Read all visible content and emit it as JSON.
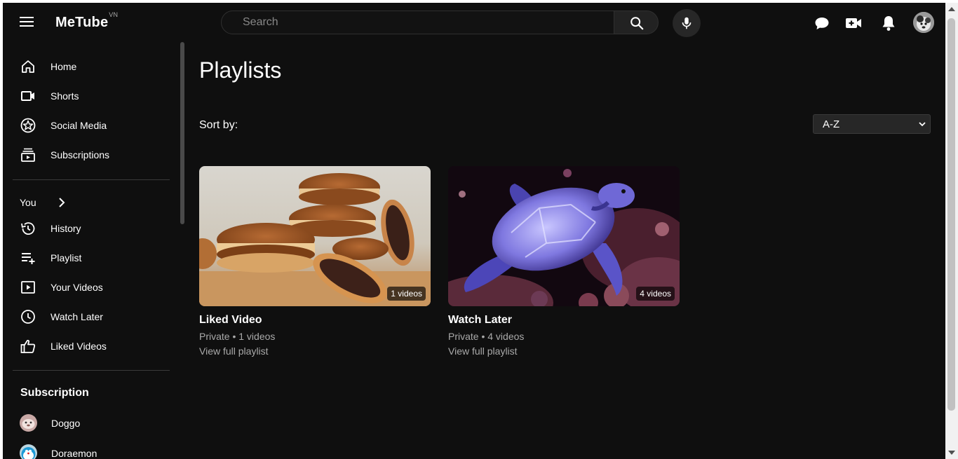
{
  "app": {
    "logo": "MeTube",
    "logo_sup": "VN"
  },
  "header": {
    "search_placeholder": "Search",
    "icons": [
      "menu-icon",
      "search-icon",
      "mic-icon",
      "chat-icon",
      "create-video-icon",
      "bell-icon",
      "avatar"
    ]
  },
  "sidebar": {
    "main": [
      {
        "label": "Home",
        "icon": "home-icon"
      },
      {
        "label": "Shorts",
        "icon": "shorts-icon"
      },
      {
        "label": "Social Media",
        "icon": "star-icon"
      },
      {
        "label": "Subscriptions",
        "icon": "subscriptions-icon"
      }
    ],
    "you_label": "You",
    "you": [
      {
        "label": "History",
        "icon": "history-icon"
      },
      {
        "label": "Playlist",
        "icon": "playlist-add-icon"
      },
      {
        "label": "Your Videos",
        "icon": "your-videos-icon"
      },
      {
        "label": "Watch Later",
        "icon": "clock-icon"
      },
      {
        "label": "Liked Videos",
        "icon": "thumbs-up-icon"
      }
    ],
    "subscription_title": "Subscription",
    "subscriptions": [
      {
        "label": "Doggo"
      },
      {
        "label": "Doraemon"
      }
    ]
  },
  "main": {
    "title": "Playlists",
    "sort_label": "Sort by:",
    "sort_value": "A-Z",
    "playlists": [
      {
        "title": "Liked Video",
        "meta": "Private • 1 videos",
        "badge": "1 videos",
        "link": "View full playlist",
        "thumb": "dorayaki-pancakes"
      },
      {
        "title": "Watch Later",
        "meta": "Private • 4 videos",
        "badge": "4 videos",
        "link": "View full playlist",
        "thumb": "sea-turtle"
      }
    ]
  },
  "colors": {
    "background": "#0f0f0f",
    "text": "#ffffff",
    "muted": "#aaaaaa"
  }
}
